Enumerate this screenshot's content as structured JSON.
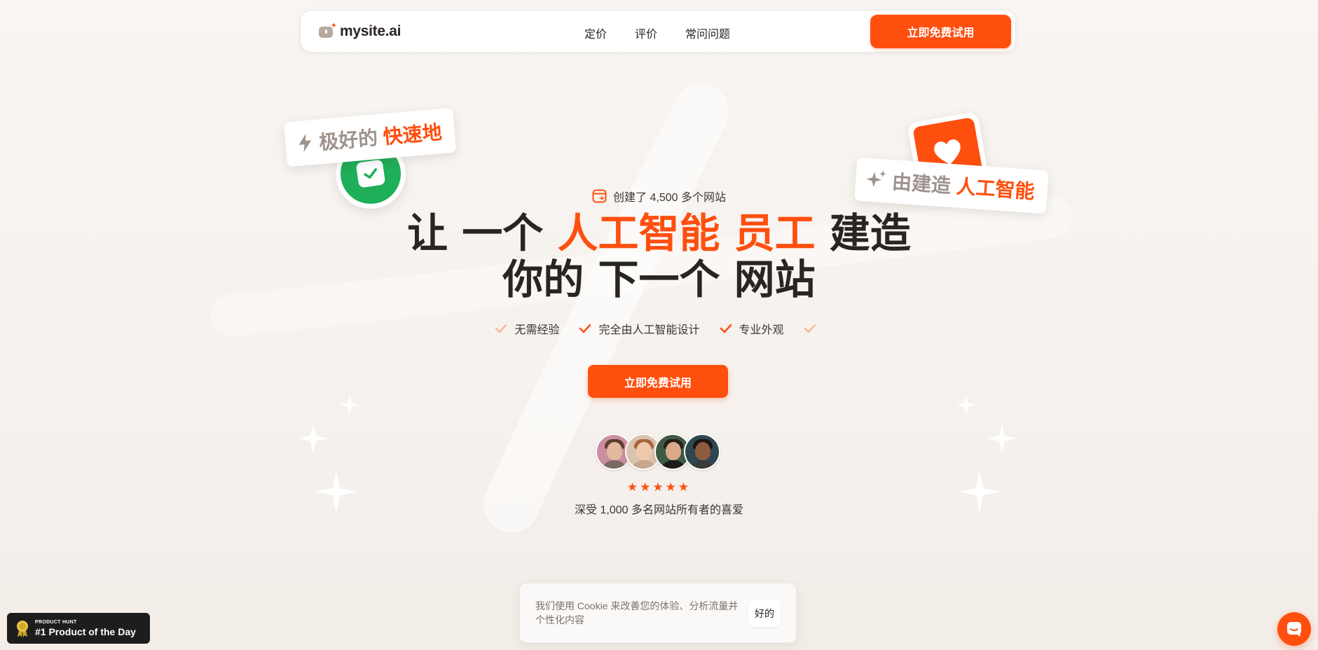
{
  "nav": {
    "logo_text": "mysite.ai",
    "links": [
      "定价",
      "评价",
      "常问问题"
    ],
    "cta_label": "立即免费试用"
  },
  "stickers": {
    "left": {
      "text": "极好的 ",
      "highlight": "快速地"
    },
    "right": {
      "text": "由建造 ",
      "highlight": "人工智能"
    }
  },
  "hero": {
    "tag": "创建了 4,500 多个网站",
    "title_parts": [
      "让 一个 ",
      "人工智能 员工",
      " 建造"
    ],
    "title_line2": "你的 下一个 网站",
    "features": [
      "无需经验",
      "完全由人工智能设计",
      "专业外观"
    ],
    "cta_label": "立即免费试用",
    "stars": "★★★★★",
    "loved_text": "深受 1,000 多名网站所有者的喜爱"
  },
  "cookie": {
    "text": "我们使用 Cookie 来改善您的体验、分析流量并个性化内容",
    "ok_label": "好的"
  },
  "product_hunt": {
    "small": "PRODUCT HUNT",
    "big": "#1 Product of the Day"
  },
  "icons": {
    "bolt": "bolt-icon",
    "sparkles": "sparkles-icon",
    "check": "check-icon",
    "heart": "heart-icon",
    "chat": "chat-icon",
    "medal": "medal-icon"
  },
  "colors": {
    "accent": "#ff4f0f",
    "green": "#1fae59",
    "text": "#2b2522",
    "background": "#f7f3ef"
  }
}
